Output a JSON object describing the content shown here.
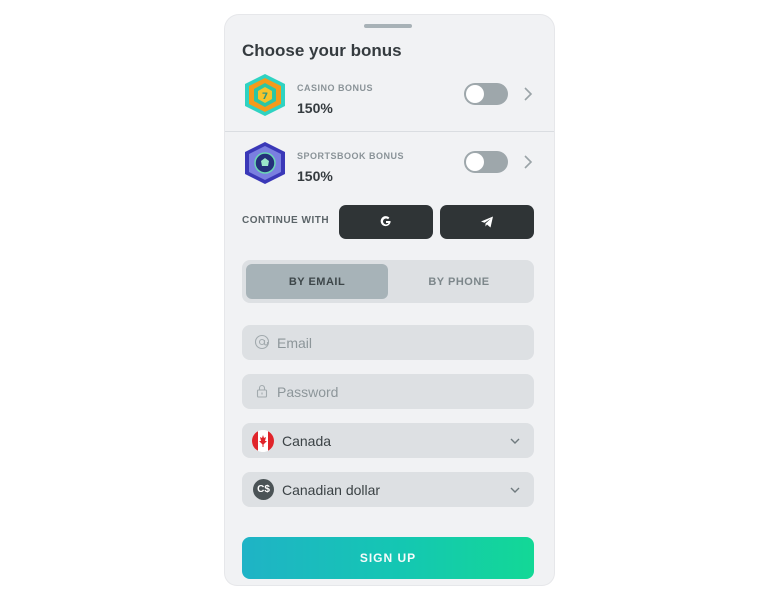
{
  "modal": {
    "title": "Choose your bonus"
  },
  "bonuses": [
    {
      "label": "CASINO BONUS",
      "value": "150%",
      "enabled": false
    },
    {
      "label": "SPORTSBOOK BONUS",
      "value": "150%",
      "enabled": false
    }
  ],
  "social": {
    "label": "CONTINUE WITH",
    "providers": [
      "google-icon",
      "telegram-icon"
    ]
  },
  "method_tabs": {
    "email": "BY EMAIL",
    "phone": "BY PHONE",
    "selected": "email"
  },
  "form": {
    "email_placeholder": "Email",
    "password_placeholder": "Password",
    "country": "Canada",
    "currency": "Canadian dollar",
    "currency_symbol": "C$"
  },
  "signup_label": "SIGN UP",
  "colors": {
    "accent_gradient_start": "#1fb3c6",
    "accent_gradient_end": "#13d896",
    "dark_button": "#2f3436",
    "toggle_off": "#9ea7ab"
  }
}
